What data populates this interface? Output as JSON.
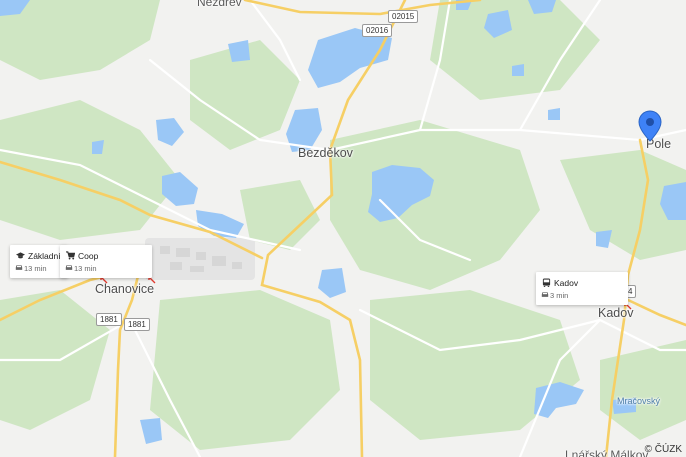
{
  "map": {
    "colors": {
      "land": "#f2f2f0",
      "forest": "#cfe6c3",
      "water": "#9ac7f6",
      "road_main": "#f6cf65",
      "road_minor": "#ffffff",
      "pin": "#3e82f7"
    },
    "places": {
      "nezdrev": "Nezdřev",
      "bezdekov": "Bezděkov",
      "pole": "Pole",
      "chanovice": "Chanovice",
      "kadov": "Kadov",
      "mracovsky": "Mračovský",
      "lnarsky_malkov": "Lnářský Málkov"
    },
    "road_shields": {
      "r02016": "02016",
      "r02015": "02015",
      "r1881": "1881",
      "r1881_b": "1881",
      "r_kadov": "4"
    },
    "poi_cards": [
      {
        "title": "Základní",
        "time": "13 min",
        "icon": "school-icon",
        "travel_icon": "car-icon"
      },
      {
        "title": "Coop",
        "time": "13 min",
        "icon": "shopping-cart-icon",
        "travel_icon": "car-icon"
      },
      {
        "title": "Kadov",
        "time": "3 min",
        "icon": "bus-icon",
        "travel_icon": "car-icon"
      }
    ],
    "pin": {
      "label": "Pole",
      "icon": "location-pin-icon"
    },
    "copyright": "© ČÚZK"
  }
}
